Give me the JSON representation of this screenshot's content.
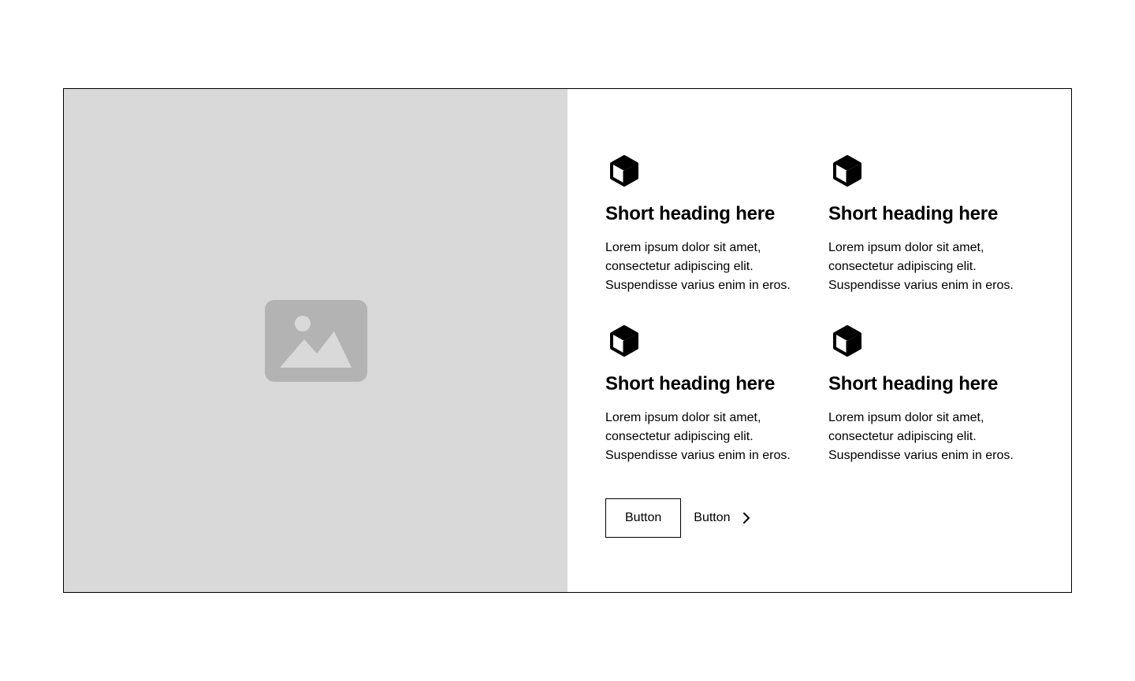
{
  "colors": {
    "image_background": "#d9d9d9",
    "placeholder_icon": "#b3b3b3",
    "border": "#000000",
    "text": "#000000"
  },
  "image": {
    "icon": "image-placeholder-icon"
  },
  "features": [
    {
      "icon": "cube-icon",
      "heading": "Short heading here",
      "text": "Lorem ipsum dolor sit amet, consectetur adipiscing elit. Suspendisse varius enim in eros."
    },
    {
      "icon": "cube-icon",
      "heading": "Short heading here",
      "text": "Lorem ipsum dolor sit amet, consectetur adipiscing elit. Suspendisse varius enim in eros."
    },
    {
      "icon": "cube-icon",
      "heading": "Short heading here",
      "text": "Lorem ipsum dolor sit amet, consectetur adipiscing elit. Suspendisse varius enim in eros."
    },
    {
      "icon": "cube-icon",
      "heading": "Short heading here",
      "text": "Lorem ipsum dolor sit amet, consectetur adipiscing elit. Suspendisse varius enim in eros."
    }
  ],
  "actions": {
    "primary_label": "Button",
    "secondary_label": "Button",
    "secondary_icon": "chevron-right-icon"
  }
}
